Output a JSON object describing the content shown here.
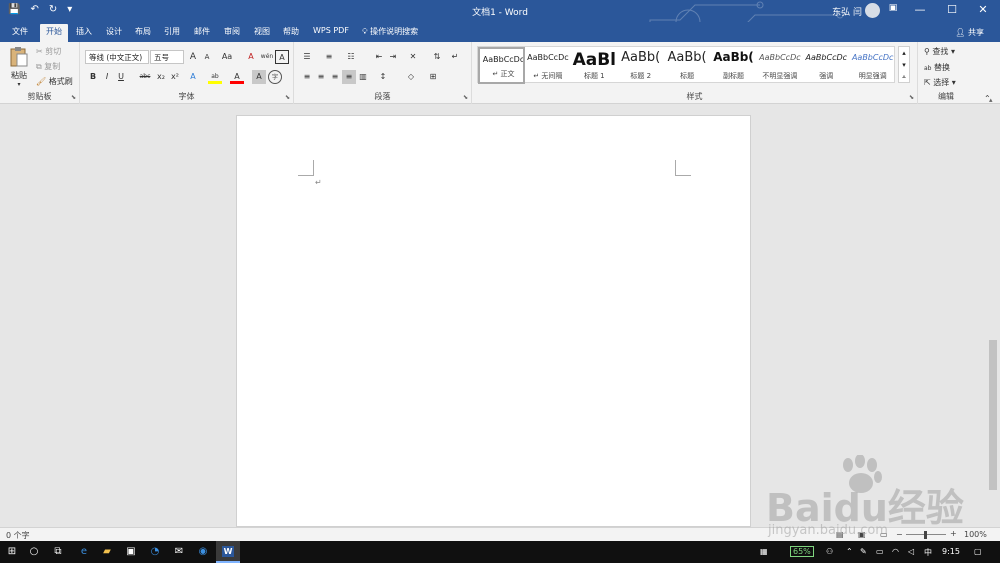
{
  "titlebar": {
    "doc_title": "文档1 - Word",
    "user_name": "东弘 闫",
    "qa_save": "💾",
    "qa_undo": "↶",
    "qa_redo": "↻",
    "qa_more": "▾"
  },
  "tabs": [
    "文件",
    "开始",
    "插入",
    "设计",
    "布局",
    "引用",
    "邮件",
    "审阅",
    "视图",
    "帮助",
    "WPS PDF"
  ],
  "active_tab": "开始",
  "tell_me": "操作说明搜索",
  "share": "共享",
  "clipboard": {
    "paste": "粘贴",
    "cut": "剪切",
    "copy": "复制",
    "format_painter": "格式刷",
    "label": "剪贴板"
  },
  "font": {
    "name": "等线 (中文正文)",
    "size": "五号",
    "label": "字体",
    "buttons": [
      "A",
      "A",
      "Aa",
      "A",
      "wén",
      "A",
      "B",
      "I",
      "U",
      "abc",
      "x₂",
      "x²",
      "A",
      "ab",
      "A",
      "A",
      "字"
    ]
  },
  "paragraph": {
    "label": "段落"
  },
  "styles": {
    "label": "样式",
    "items": [
      {
        "sample": "AaBbCcDc",
        "name": "↵ 正文",
        "size": "8",
        "weight": "normal",
        "italic": false,
        "color": "#222"
      },
      {
        "sample": "AaBbCcDc",
        "name": "↵ 无间隔",
        "size": "8",
        "weight": "normal",
        "italic": false,
        "color": "#222"
      },
      {
        "sample": "AaBl",
        "name": "标题 1",
        "size": "17",
        "weight": "bold",
        "italic": false,
        "color": "#111"
      },
      {
        "sample": "AaBb(",
        "name": "标题 2",
        "size": "13",
        "weight": "normal",
        "italic": false,
        "color": "#222"
      },
      {
        "sample": "AaBb(",
        "name": "标题",
        "size": "13",
        "weight": "normal",
        "italic": false,
        "color": "#222"
      },
      {
        "sample": "AaBb(",
        "name": "副标题",
        "size": "12",
        "weight": "bold",
        "italic": false,
        "color": "#111"
      },
      {
        "sample": "AaBbCcDc",
        "name": "不明显强调",
        "size": "8",
        "weight": "normal",
        "italic": true,
        "color": "#555"
      },
      {
        "sample": "AaBbCcDc",
        "name": "强调",
        "size": "8",
        "weight": "normal",
        "italic": true,
        "color": "#222"
      },
      {
        "sample": "AaBbCcDc",
        "name": "明显强调",
        "size": "8",
        "weight": "normal",
        "italic": true,
        "color": "#4472c4"
      }
    ]
  },
  "editing": {
    "find": "查找",
    "replace": "替换",
    "select": "选择",
    "label": "编辑"
  },
  "document": {
    "paragraph_mark": "↵"
  },
  "statusbar": {
    "word_count": "0 个字",
    "zoom": "100%"
  },
  "taskbar": {
    "battery": "65%",
    "ime": "中",
    "time": "9:15"
  },
  "watermark": {
    "main": "Baidu经验",
    "url": "jingyan.baidu.com"
  },
  "colors": {
    "word_blue": "#2b579a",
    "ribbon_bg": "#f3f3f3",
    "canvas_bg": "#e6e6e6",
    "highlight_yellow": "#ffff00",
    "font_red": "#ff0000"
  }
}
